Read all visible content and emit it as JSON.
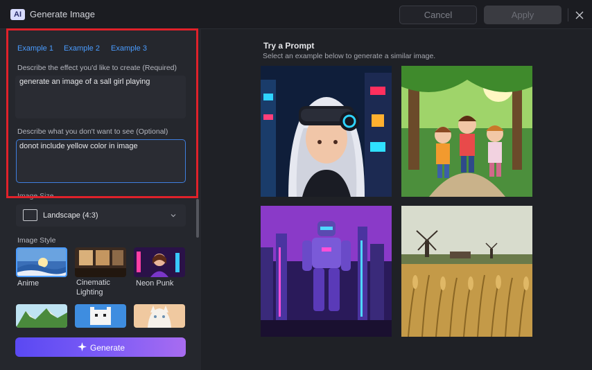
{
  "window": {
    "title": "Generate Image",
    "logo_text": "AI",
    "cancel_label": "Cancel",
    "apply_label": "Apply"
  },
  "tabs": [
    "Example 1",
    "Example 2",
    "Example 3"
  ],
  "prompt": {
    "label": "Describe the effect you'd like to create (Required)",
    "value": "generate an image of a sall girl playing"
  },
  "negative_prompt": {
    "label": "Describe what you don't want to see (Optional)",
    "value": "donot include yellow color in image"
  },
  "image_size": {
    "label": "Image Size",
    "selected": "Landscape (4:3)"
  },
  "image_style": {
    "label": "Image Style",
    "styles": [
      {
        "name": "Anime",
        "selected": true
      },
      {
        "name": "Cinematic Lighting",
        "line1": "Cinematic",
        "line2": "Lighting",
        "selected": false
      },
      {
        "name": "Neon Punk",
        "selected": false
      }
    ]
  },
  "generate_label": "Generate",
  "try_prompt": {
    "title": "Try a Prompt",
    "subtitle": "Select an example below to generate a similar image."
  },
  "colors": {
    "accent": "#4a9cff",
    "highlight_box": "#e0212a",
    "generate_gradient_start": "#5a49f2",
    "generate_gradient_end": "#a86cf0"
  }
}
